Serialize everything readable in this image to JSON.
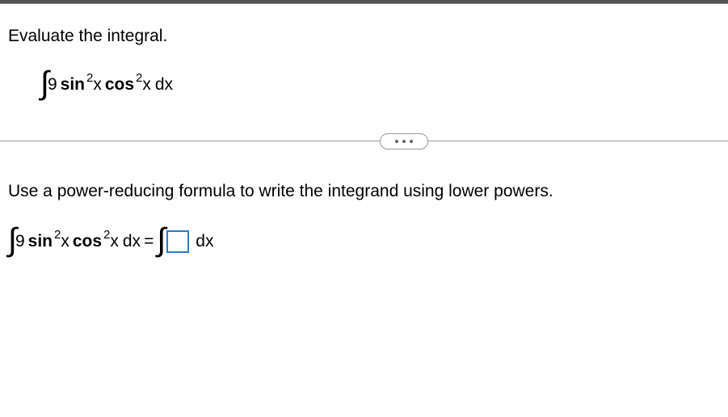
{
  "problem": {
    "title": "Evaluate the integral.",
    "integral": {
      "coefficient": "9",
      "trig1": "sin",
      "power1": "2",
      "var1": "x",
      "trig2": "cos",
      "power2": "2",
      "var2": "x",
      "differential": "dx"
    }
  },
  "instruction": "Use a power-reducing formula to write the integrand using lower powers.",
  "equation": {
    "lhs": {
      "coefficient": "9",
      "trig1": "sin",
      "power1": "2",
      "var1": "x",
      "trig2": "cos",
      "power2": "2",
      "var2": "x",
      "differential": "dx"
    },
    "equals": "=",
    "rhs_differential": "dx"
  }
}
